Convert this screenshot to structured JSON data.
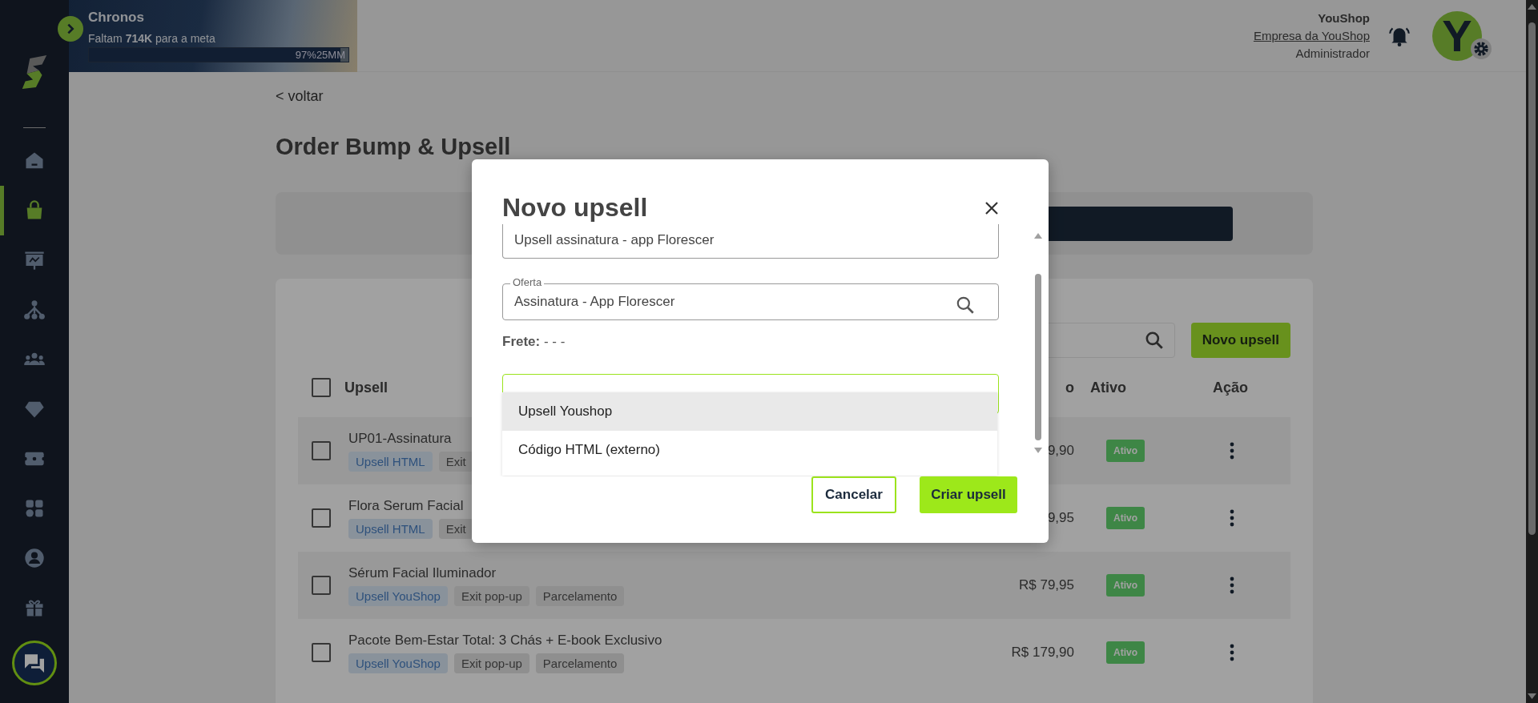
{
  "sidebar": {
    "items": [
      {
        "kind": "home",
        "selected": false
      },
      {
        "kind": "bag",
        "selected": true
      },
      {
        "kind": "board",
        "selected": false
      },
      {
        "kind": "network",
        "selected": false
      },
      {
        "kind": "people",
        "selected": false
      },
      {
        "kind": "diamond",
        "selected": false
      },
      {
        "kind": "ticket",
        "selected": false
      },
      {
        "kind": "grid",
        "selected": false
      },
      {
        "kind": "user",
        "selected": false
      },
      {
        "kind": "gift",
        "selected": false
      }
    ]
  },
  "banner": {
    "title": "Chronos",
    "subtitle": "Faltam **714K** para a meta",
    "progress": {
      "label": "97%25MM",
      "level": 0.97
    }
  },
  "account": {
    "name": "YouShop",
    "company": "Empresa da YouShop",
    "role": "Administrador",
    "avatar_letter": "Y"
  },
  "page": {
    "back_link": "< voltar",
    "title": "Order Bump & Upsell"
  },
  "toolbar": {
    "new_button": "Novo upsell"
  },
  "table": {
    "header_checked": false,
    "columns": [
      "Upsell",
      "o",
      "Ativo",
      "Ação"
    ],
    "rows": [
      {
        "checked": false,
        "name": "UP01-Assinatura",
        "tags": [
          {
            "label": "Upsell HTML",
            "kind": "type"
          },
          {
            "label": "Exit",
            "kind": "feature"
          }
        ],
        "price": "9,90",
        "status": "Ativo"
      },
      {
        "checked": false,
        "name": "Flora Serum Facial",
        "tags": [
          {
            "label": "Upsell HTML",
            "kind": "type"
          },
          {
            "label": "Exit",
            "kind": "feature"
          }
        ],
        "price": "9,95",
        "status": "Ativo"
      },
      {
        "checked": false,
        "name": "Sérum Facial Iluminador",
        "tags": [
          {
            "label": "Upsell YouShop",
            "kind": "type"
          },
          {
            "label": "Exit pop-up",
            "kind": "feature"
          },
          {
            "label": "Parcelamento",
            "kind": "feature"
          }
        ],
        "price": "R$ 79,95",
        "status": "Ativo"
      },
      {
        "checked": false,
        "name": "Pacote Bem-Estar Total: 3 Chás + E-book Exclusivo",
        "tags": [
          {
            "label": "Upsell YouShop",
            "kind": "type"
          },
          {
            "label": "Exit pop-up",
            "kind": "feature"
          },
          {
            "label": "Parcelamento",
            "kind": "feature"
          }
        ],
        "price": "R$ 179,90",
        "status": "Ativo"
      }
    ]
  },
  "modal": {
    "title": "Novo upsell",
    "name_field": {
      "value": "Upsell assinatura - app Florescer"
    },
    "offer_field": {
      "label": "Oferta",
      "value": "Assinatura - App Florescer"
    },
    "shipping": {
      "label": "Frete:",
      "value": "- - -"
    },
    "type_options": [
      {
        "label": "Upsell Youshop",
        "selected": true
      },
      {
        "label": "Código HTML (externo)",
        "selected": false
      }
    ],
    "cancel_button": "Cancelar",
    "confirm_button": "Criar upsell"
  }
}
